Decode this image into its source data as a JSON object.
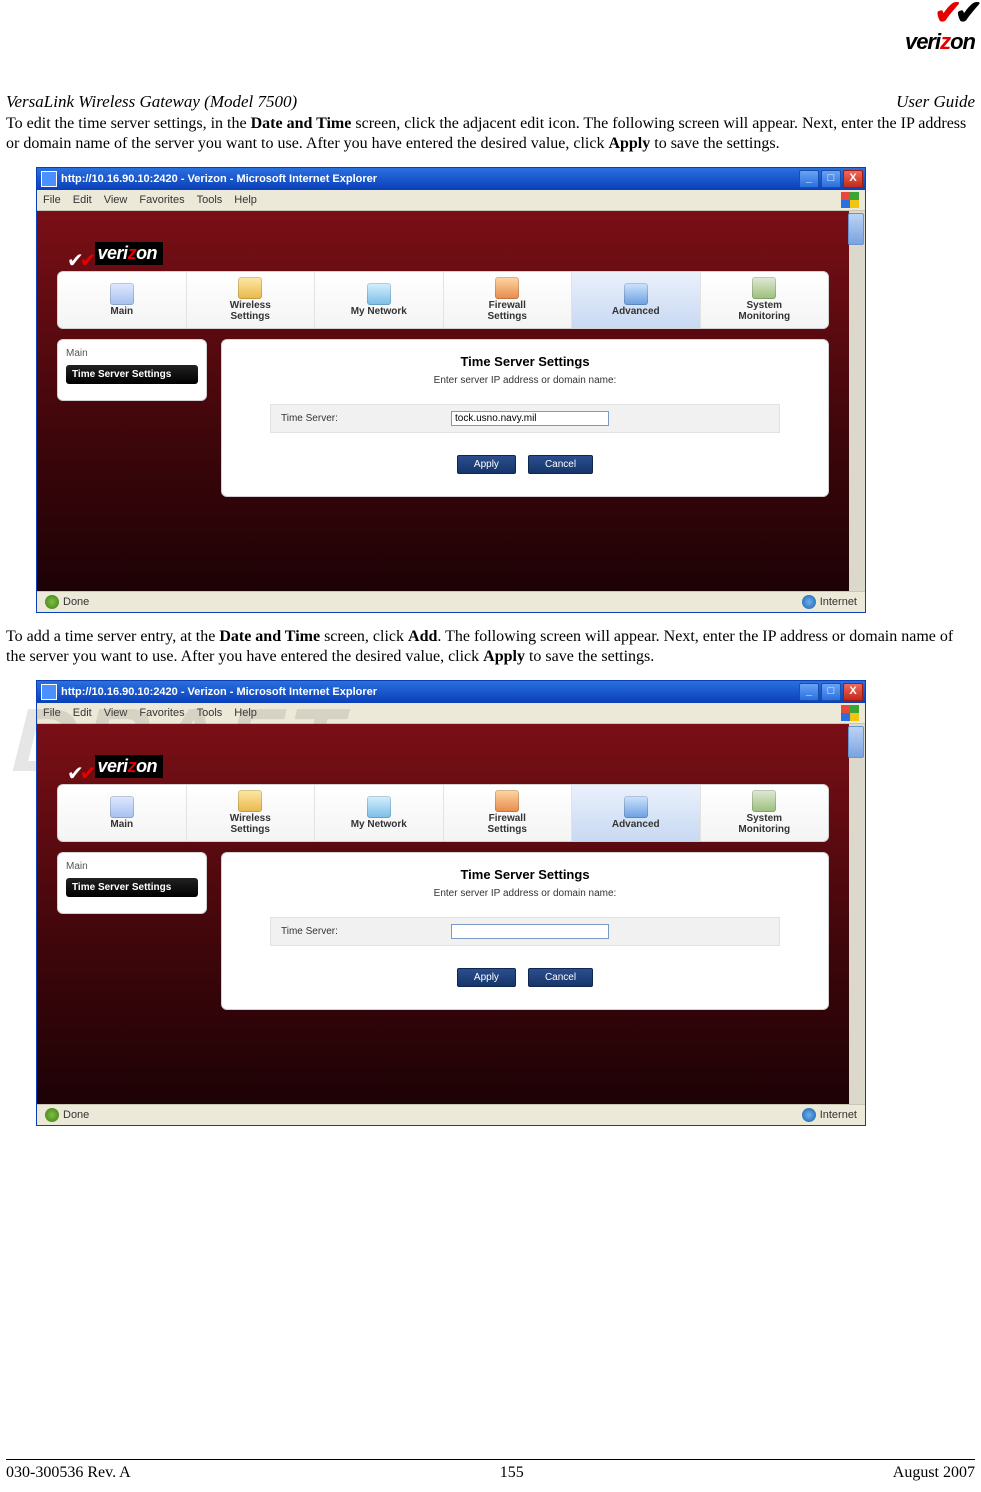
{
  "logo_text": "verizon",
  "header": {
    "left": "VersaLink Wireless Gateway (Model 7500)",
    "right": "User Guide"
  },
  "para1_a": "To edit the time server settings, in the ",
  "para1_b": "Date and Time",
  "para1_c": " screen, click the adjacent edit icon. The following screen will appear. Next, enter the IP address or domain name of the server you want to use. After you have entered the desired value, click ",
  "para1_d": "Apply",
  "para1_e": " to save the settings.",
  "para2_a": "To add a time server entry, at the ",
  "para2_b": "Date and Time",
  "para2_c": " screen, click ",
  "para2_d": "Add",
  "para2_e": ". The following screen will appear. Next, enter the IP address or domain name of the server you want to use. After you have entered the desired value, click ",
  "para2_f": "Apply",
  "para2_g": " to save the settings.",
  "browser": {
    "title": "http://10.16.90.10:2420 - Verizon - Microsoft Internet Explorer",
    "menu": [
      "File",
      "Edit",
      "View",
      "Favorites",
      "Tools",
      "Help"
    ],
    "status_left": "Done",
    "status_right": "Internet",
    "win_min": "_",
    "win_max": "□",
    "win_close": "X"
  },
  "nav": {
    "t1": "Main",
    "t2a": "Wireless",
    "t2b": "Settings",
    "t3": "My Network",
    "t4a": "Firewall",
    "t4b": "Settings",
    "t5": "Advanced",
    "t6a": "System",
    "t6b": "Monitoring"
  },
  "side": {
    "main": "Main",
    "item": "Time Server Settings"
  },
  "card": {
    "title": "Time Server Settings",
    "sub": "Enter server IP address or domain name:",
    "label": "Time Server:",
    "value_edit": "tock.usno.navy.mil",
    "value_add": "",
    "apply": "Apply",
    "cancel": "Cancel"
  },
  "footer": {
    "left": "030-300536 Rev. A",
    "center": "155",
    "right": "August 2007"
  },
  "watermark": "DRAFT"
}
